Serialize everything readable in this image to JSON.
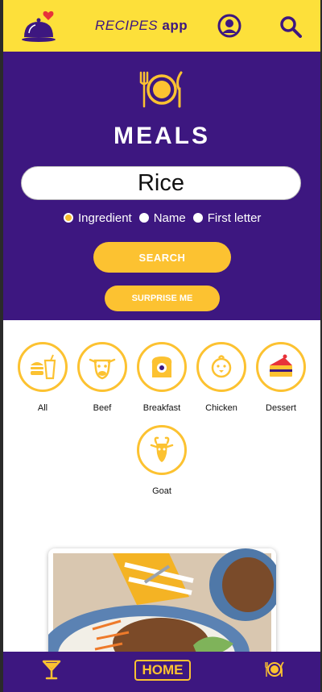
{
  "header": {
    "title_part1": "RECIPES",
    "title_part2": "app",
    "logo_icon": "cloche-heart-icon",
    "profile_icon": "profile-icon",
    "search_icon": "search-icon"
  },
  "hero": {
    "title": "MEALS",
    "icon": "plate-cutlery-icon",
    "search_value": "Rice",
    "radio_options": [
      {
        "label": "Ingredient",
        "checked": true
      },
      {
        "label": "Name",
        "checked": false
      },
      {
        "label": "First letter",
        "checked": false
      }
    ],
    "search_button": "SEARCH",
    "surprise_button": "SURPRISE ME"
  },
  "categories": [
    {
      "label": "All",
      "icon": "fast-food-icon"
    },
    {
      "label": "Beef",
      "icon": "cow-icon"
    },
    {
      "label": "Breakfast",
      "icon": "toast-icon"
    },
    {
      "label": "Chicken",
      "icon": "chick-icon"
    },
    {
      "label": "Dessert",
      "icon": "cake-icon"
    },
    {
      "label": "Goat",
      "icon": "goat-icon"
    }
  ],
  "bottom_nav": {
    "drinks_icon": "cocktail-icon",
    "home_label": "HOME",
    "meals_icon": "plate-cutlery-icon"
  },
  "colors": {
    "purple": "#3d1780",
    "yellow": "#fde03a",
    "accent": "#fcc231"
  }
}
